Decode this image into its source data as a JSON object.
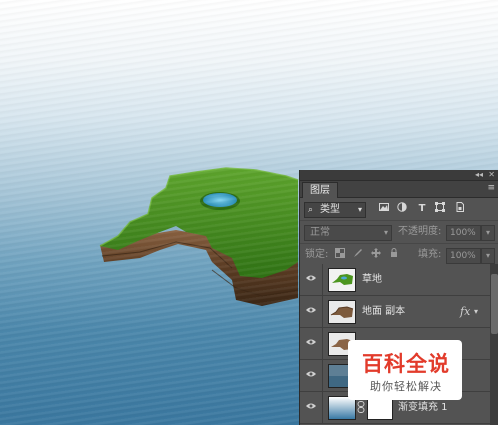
{
  "panel": {
    "tab_label": "图层",
    "collapse_glyph": "◂◂",
    "close_glyph": "✕",
    "menu_glyph": "≡",
    "filter": {
      "selected": "类型",
      "search_glyph": "⌕",
      "arrow": "▾",
      "icons": [
        "image-filter-icon",
        "adjustment-filter-icon",
        "type-filter-icon",
        "shape-filter-icon",
        "smart-object-filter-icon"
      ]
    },
    "blend_mode": {
      "selected": "正常",
      "arrow": "▾"
    },
    "opacity": {
      "label": "不透明度:",
      "value": "100%",
      "arrow": "▾"
    },
    "lock": {
      "label": "锁定:"
    },
    "fill": {
      "label": "填充:",
      "value": "100%",
      "arrow": "▾"
    },
    "layers": [
      {
        "name": "草地",
        "fx": "",
        "thumb": "grass"
      },
      {
        "name": "地面 副本",
        "fx": "fx",
        "thumb": "ground"
      },
      {
        "name": "",
        "fx": "",
        "thumb": "ground"
      },
      {
        "name": "",
        "fx": "",
        "thumb": "water"
      },
      {
        "name": "渐变填充 1",
        "fx": "",
        "thumb": "gradient"
      }
    ]
  },
  "watermark": {
    "title": "百科全说",
    "subtitle": "助你轻松解决"
  },
  "colors": {
    "panel_bg": "#535353",
    "watermark_red": "#e23b2b",
    "grass": "#3f8a1e",
    "soil": "#6e4a2e"
  }
}
